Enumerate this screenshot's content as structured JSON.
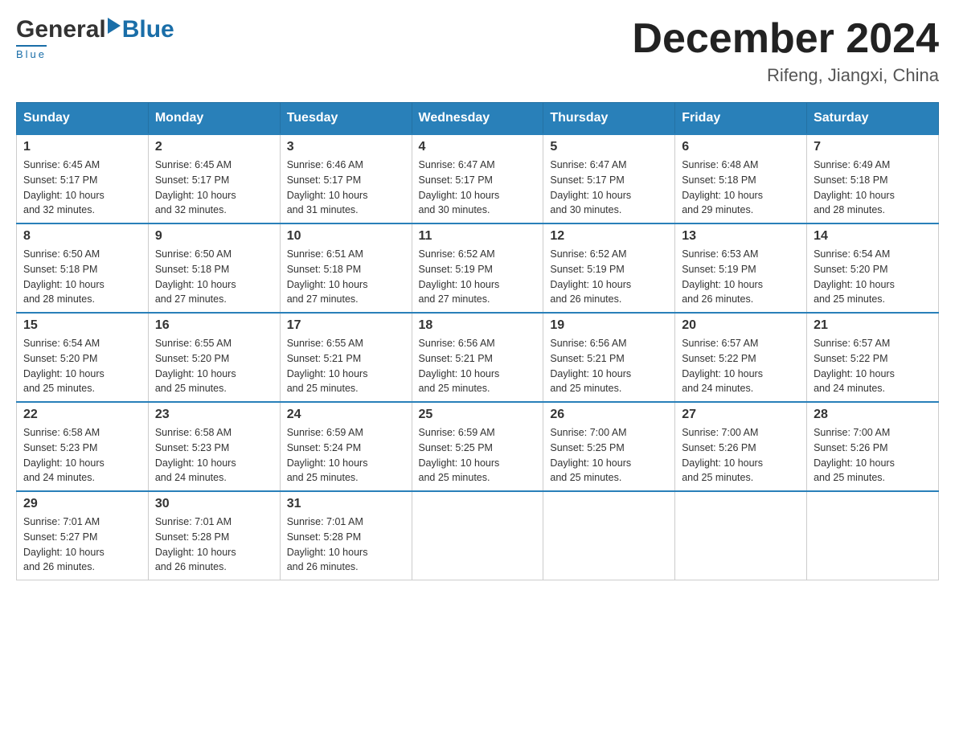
{
  "header": {
    "logo_general": "General",
    "logo_blue": "Blue",
    "logo_underline": "Blue",
    "month_title": "December 2024",
    "location": "Rifeng, Jiangxi, China"
  },
  "days_of_week": [
    "Sunday",
    "Monday",
    "Tuesday",
    "Wednesday",
    "Thursday",
    "Friday",
    "Saturday"
  ],
  "weeks": [
    [
      {
        "day": "1",
        "sunrise": "6:45 AM",
        "sunset": "5:17 PM",
        "daylight": "10 hours and 32 minutes."
      },
      {
        "day": "2",
        "sunrise": "6:45 AM",
        "sunset": "5:17 PM",
        "daylight": "10 hours and 32 minutes."
      },
      {
        "day": "3",
        "sunrise": "6:46 AM",
        "sunset": "5:17 PM",
        "daylight": "10 hours and 31 minutes."
      },
      {
        "day": "4",
        "sunrise": "6:47 AM",
        "sunset": "5:17 PM",
        "daylight": "10 hours and 30 minutes."
      },
      {
        "day": "5",
        "sunrise": "6:47 AM",
        "sunset": "5:17 PM",
        "daylight": "10 hours and 30 minutes."
      },
      {
        "day": "6",
        "sunrise": "6:48 AM",
        "sunset": "5:18 PM",
        "daylight": "10 hours and 29 minutes."
      },
      {
        "day": "7",
        "sunrise": "6:49 AM",
        "sunset": "5:18 PM",
        "daylight": "10 hours and 28 minutes."
      }
    ],
    [
      {
        "day": "8",
        "sunrise": "6:50 AM",
        "sunset": "5:18 PM",
        "daylight": "10 hours and 28 minutes."
      },
      {
        "day": "9",
        "sunrise": "6:50 AM",
        "sunset": "5:18 PM",
        "daylight": "10 hours and 27 minutes."
      },
      {
        "day": "10",
        "sunrise": "6:51 AM",
        "sunset": "5:18 PM",
        "daylight": "10 hours and 27 minutes."
      },
      {
        "day": "11",
        "sunrise": "6:52 AM",
        "sunset": "5:19 PM",
        "daylight": "10 hours and 27 minutes."
      },
      {
        "day": "12",
        "sunrise": "6:52 AM",
        "sunset": "5:19 PM",
        "daylight": "10 hours and 26 minutes."
      },
      {
        "day": "13",
        "sunrise": "6:53 AM",
        "sunset": "5:19 PM",
        "daylight": "10 hours and 26 minutes."
      },
      {
        "day": "14",
        "sunrise": "6:54 AM",
        "sunset": "5:20 PM",
        "daylight": "10 hours and 25 minutes."
      }
    ],
    [
      {
        "day": "15",
        "sunrise": "6:54 AM",
        "sunset": "5:20 PM",
        "daylight": "10 hours and 25 minutes."
      },
      {
        "day": "16",
        "sunrise": "6:55 AM",
        "sunset": "5:20 PM",
        "daylight": "10 hours and 25 minutes."
      },
      {
        "day": "17",
        "sunrise": "6:55 AM",
        "sunset": "5:21 PM",
        "daylight": "10 hours and 25 minutes."
      },
      {
        "day": "18",
        "sunrise": "6:56 AM",
        "sunset": "5:21 PM",
        "daylight": "10 hours and 25 minutes."
      },
      {
        "day": "19",
        "sunrise": "6:56 AM",
        "sunset": "5:21 PM",
        "daylight": "10 hours and 25 minutes."
      },
      {
        "day": "20",
        "sunrise": "6:57 AM",
        "sunset": "5:22 PM",
        "daylight": "10 hours and 24 minutes."
      },
      {
        "day": "21",
        "sunrise": "6:57 AM",
        "sunset": "5:22 PM",
        "daylight": "10 hours and 24 minutes."
      }
    ],
    [
      {
        "day": "22",
        "sunrise": "6:58 AM",
        "sunset": "5:23 PM",
        "daylight": "10 hours and 24 minutes."
      },
      {
        "day": "23",
        "sunrise": "6:58 AM",
        "sunset": "5:23 PM",
        "daylight": "10 hours and 24 minutes."
      },
      {
        "day": "24",
        "sunrise": "6:59 AM",
        "sunset": "5:24 PM",
        "daylight": "10 hours and 25 minutes."
      },
      {
        "day": "25",
        "sunrise": "6:59 AM",
        "sunset": "5:25 PM",
        "daylight": "10 hours and 25 minutes."
      },
      {
        "day": "26",
        "sunrise": "7:00 AM",
        "sunset": "5:25 PM",
        "daylight": "10 hours and 25 minutes."
      },
      {
        "day": "27",
        "sunrise": "7:00 AM",
        "sunset": "5:26 PM",
        "daylight": "10 hours and 25 minutes."
      },
      {
        "day": "28",
        "sunrise": "7:00 AM",
        "sunset": "5:26 PM",
        "daylight": "10 hours and 25 minutes."
      }
    ],
    [
      {
        "day": "29",
        "sunrise": "7:01 AM",
        "sunset": "5:27 PM",
        "daylight": "10 hours and 26 minutes."
      },
      {
        "day": "30",
        "sunrise": "7:01 AM",
        "sunset": "5:28 PM",
        "daylight": "10 hours and 26 minutes."
      },
      {
        "day": "31",
        "sunrise": "7:01 AM",
        "sunset": "5:28 PM",
        "daylight": "10 hours and 26 minutes."
      },
      null,
      null,
      null,
      null
    ]
  ],
  "labels": {
    "sunrise": "Sunrise:",
    "sunset": "Sunset:",
    "daylight": "Daylight:"
  }
}
